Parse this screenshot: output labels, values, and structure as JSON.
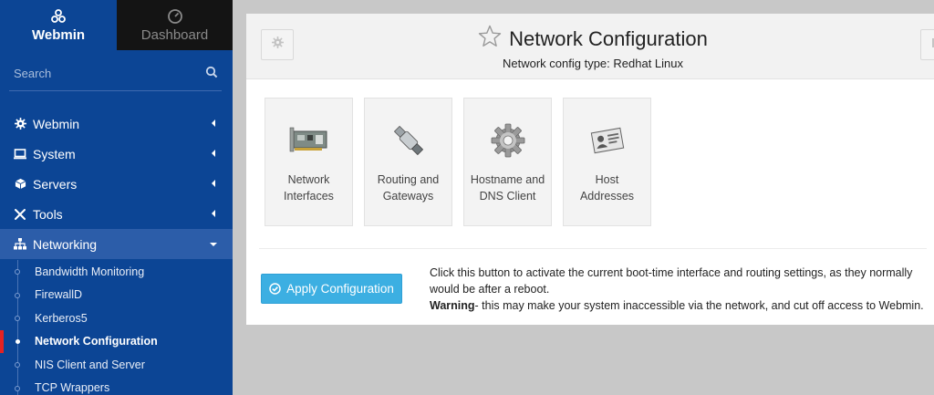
{
  "sidebar": {
    "tabs": [
      {
        "label": "Webmin",
        "icon": "webmin-logo-icon",
        "active": true
      },
      {
        "label": "Dashboard",
        "icon": "dashboard-gauge-icon",
        "active": false
      }
    ],
    "search_placeholder": "Search",
    "nav": [
      {
        "label": "Webmin",
        "icon": "gear-icon"
      },
      {
        "label": "System",
        "icon": "monitor-icon"
      },
      {
        "label": "Servers",
        "icon": "cube-icon"
      },
      {
        "label": "Tools",
        "icon": "wrench-icon"
      },
      {
        "label": "Networking",
        "icon": "sitemap-icon",
        "expanded": true
      }
    ],
    "sub_items": [
      {
        "label": "Bandwidth Monitoring"
      },
      {
        "label": "FirewallD"
      },
      {
        "label": "Kerberos5"
      },
      {
        "label": "Network Configuration",
        "active": true
      },
      {
        "label": "NIS Client and Server"
      },
      {
        "label": "TCP Wrappers"
      }
    ]
  },
  "page": {
    "title": "Network Configuration",
    "subtitle": "Network config type: Redhat Linux",
    "tiles": [
      {
        "label": "Network\nInterfaces",
        "icon": "network-card-icon"
      },
      {
        "label": "Routing and\nGateways",
        "icon": "cable-connector-icon"
      },
      {
        "label": "Hostname and\nDNS Client",
        "icon": "cog-icon"
      },
      {
        "label": "Host\nAddresses",
        "icon": "address-card-icon"
      }
    ],
    "apply": {
      "button_label": "Apply Configuration",
      "description": "Click this button to activate the current boot-time interface and routing settings, as they normally would be after a reboot.",
      "warning_label": "Warning",
      "warning_text": "- this may make your system inaccessible via the network, and cut off access to Webmin."
    }
  },
  "colors": {
    "sidebar_bg": "#0c4595",
    "sidebar_active": "#2c5da9",
    "accent_red": "#e52222",
    "apply_button": "#3cafe2"
  }
}
